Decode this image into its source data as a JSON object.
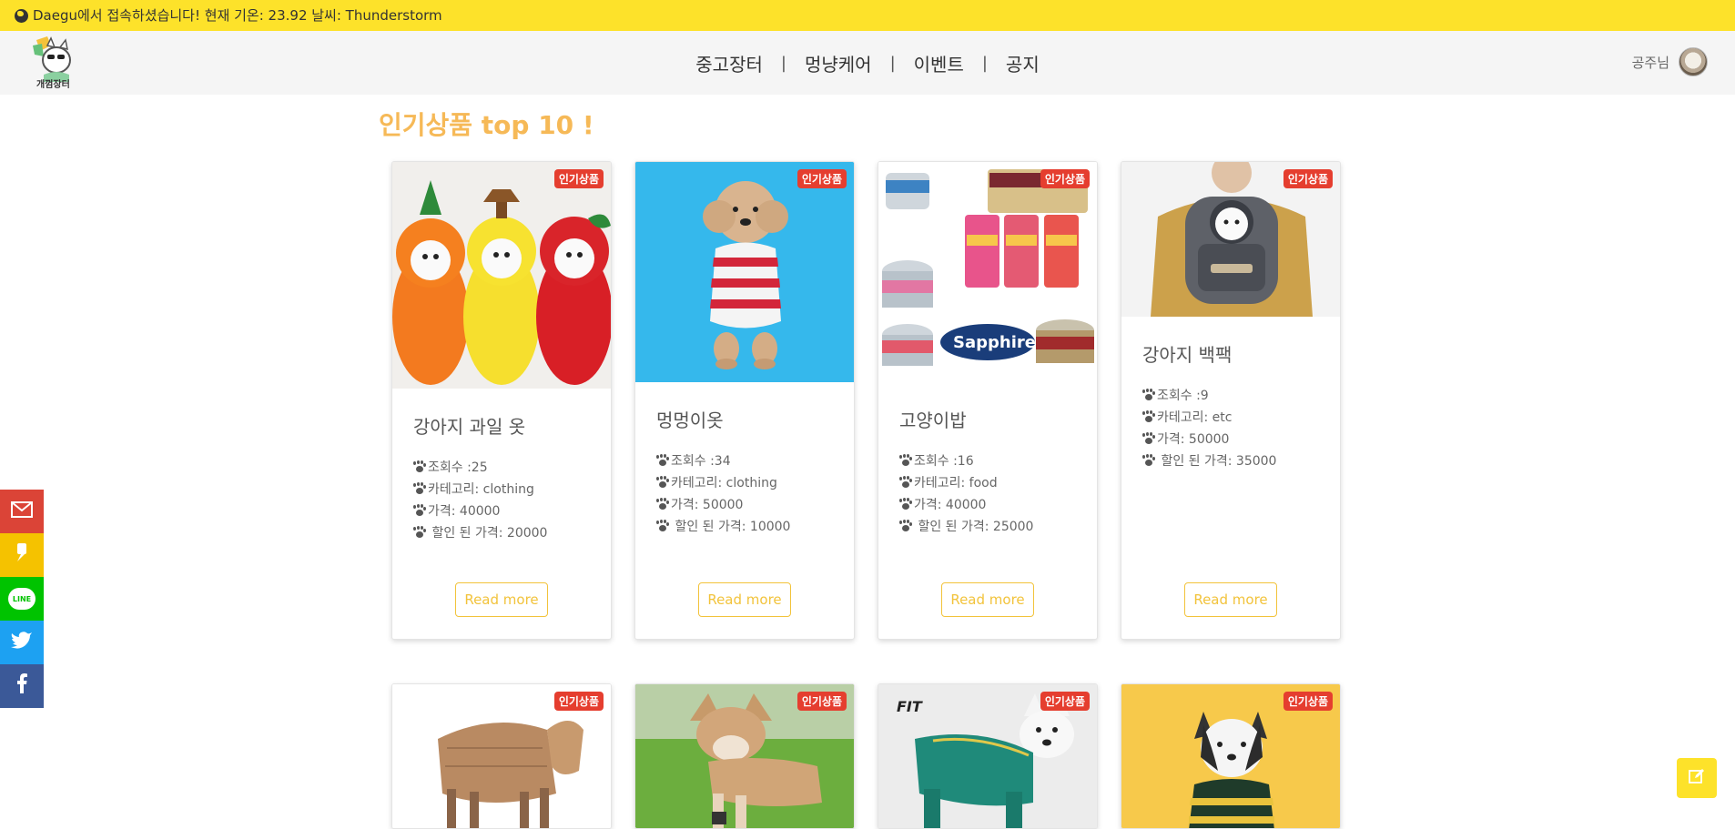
{
  "notice": {
    "text": "Daegu에서 접속하셨습니다! 현재 기온: 23.92 날씨: Thunderstorm"
  },
  "nav": {
    "items": [
      "중고장터",
      "멍냥케어",
      "이벤트",
      "공지"
    ],
    "separator": "|"
  },
  "user": {
    "name": "공주님"
  },
  "section": {
    "title": "인기상품 top 10 !"
  },
  "products": [
    {
      "badge": "인기상품",
      "title": "강아지 과일 옷",
      "views": "조회수 :25",
      "category": "카테고리: clothing",
      "price": "가격: 40000",
      "discount": "할인 된 가격: 20000",
      "read_more": "Read more"
    },
    {
      "badge": "인기상품",
      "title": "멍멍이옷",
      "views": "조회수 :34",
      "category": "카테고리: clothing",
      "price": "가격: 50000",
      "discount": "할인 된 가격: 10000",
      "read_more": "Read more"
    },
    {
      "badge": "인기상품",
      "title": "고양이밥",
      "views": "조회수 :16",
      "category": "카테고리: food",
      "price": "가격: 40000",
      "discount": "할인 된 가격: 25000",
      "read_more": "Read more"
    },
    {
      "badge": "인기상품",
      "title": "강아지 백팩",
      "views": "조회수 :9",
      "category": "카테고리: etc",
      "price": "가격: 50000",
      "discount": "할인 된 가격: 35000",
      "read_more": "Read more"
    }
  ],
  "products_row2": [
    {
      "badge": "인기상품"
    },
    {
      "badge": "인기상품"
    },
    {
      "badge": "인기상품"
    },
    {
      "badge": "인기상품"
    }
  ],
  "share": [
    {
      "icon": "gmail-icon",
      "color": "#db4437"
    },
    {
      "icon": "kakao-icon",
      "color": "#f5c200"
    },
    {
      "icon": "line-icon",
      "color": "#00c300",
      "label": "LINE"
    },
    {
      "icon": "twitter-icon",
      "color": "#1da1f2"
    },
    {
      "icon": "facebook-icon",
      "color": "#3b5998"
    }
  ],
  "colors": {
    "brand_yellow": "#fde22a",
    "title_orange": "#f6b957",
    "badge_red": "#e53e2f"
  }
}
